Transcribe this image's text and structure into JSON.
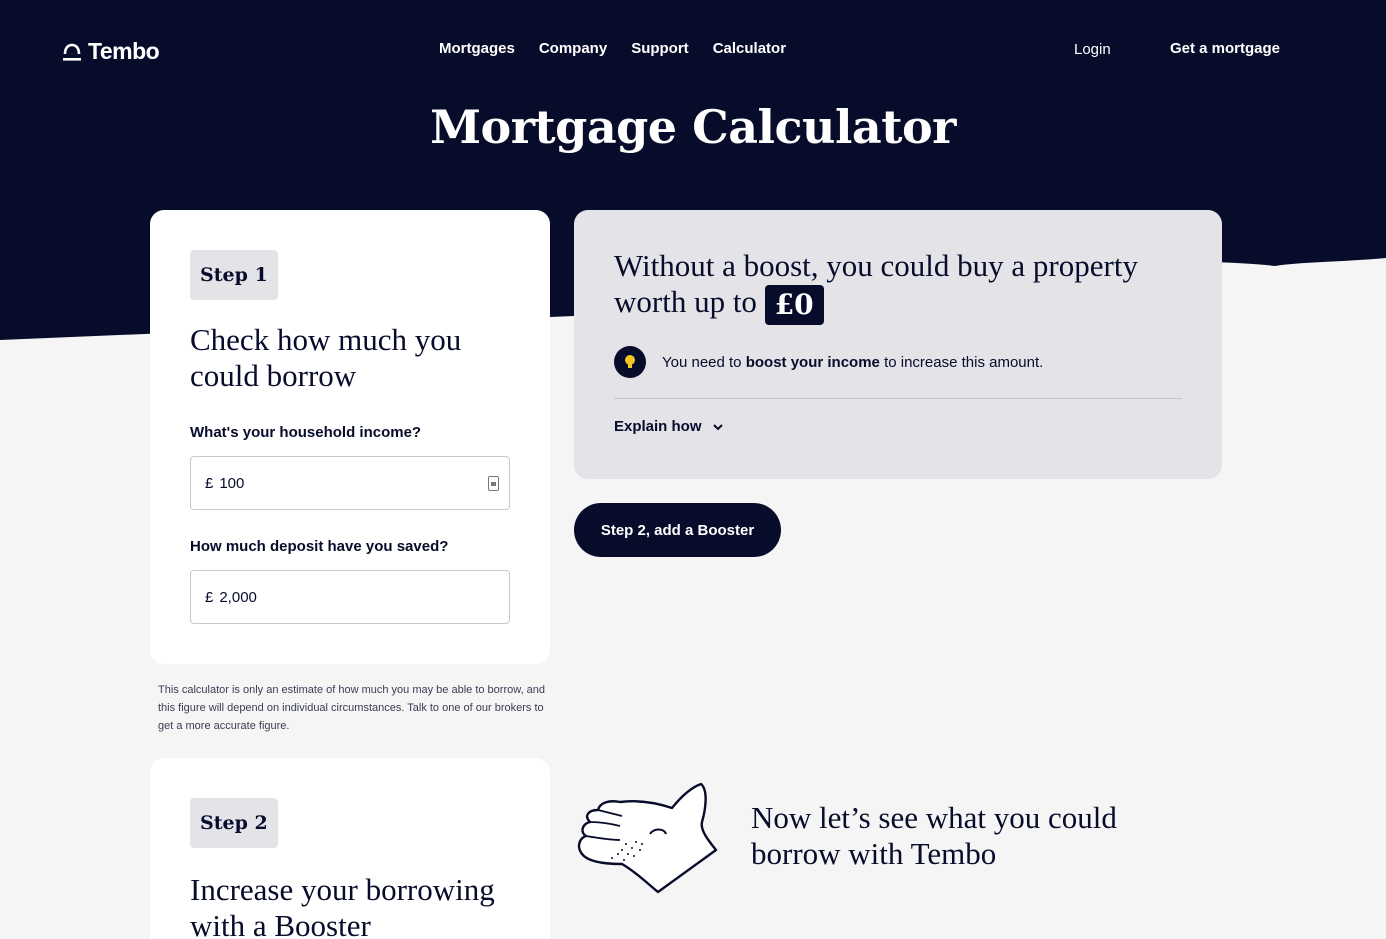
{
  "brand": {
    "name": "Tembo",
    "navy": "#080c2b",
    "page_bg": "#f5f5f5",
    "panel_bg": "#e3e3e8",
    "bulb_color": "#f3c623"
  },
  "nav": {
    "links": [
      "Mortgages",
      "Company",
      "Support",
      "Calculator"
    ],
    "login": "Login",
    "get_mortgage": "Get a mortgage"
  },
  "page_title": "Mortgage Calculator",
  "step1": {
    "badge": "Step 1",
    "heading": "Check how much you could borrow",
    "income_label": "What's your household income?",
    "income_currency": "£",
    "income_value": "100",
    "deposit_label": "How much deposit have you saved?",
    "deposit_currency": "£",
    "deposit_value": "2,000"
  },
  "disclaimer": "This calculator is only an estimate of how much you may be able to borrow, and this figure will depend on individual circumstances. Talk to one of our brokers to get a more accurate figure.",
  "result": {
    "heading_prefix": "Without a boost, you could buy a property worth up to",
    "amount": "£0",
    "tip_before": "You need to",
    "tip_bold": "boost your income",
    "tip_after": "to increase this amount.",
    "explain": "Explain how"
  },
  "cta": "Step 2, add a Booster",
  "step2": {
    "badge": "Step 2",
    "heading": "Increase your borrowing with a Booster"
  },
  "promo": "Now let’s see what you could borrow with Tembo"
}
